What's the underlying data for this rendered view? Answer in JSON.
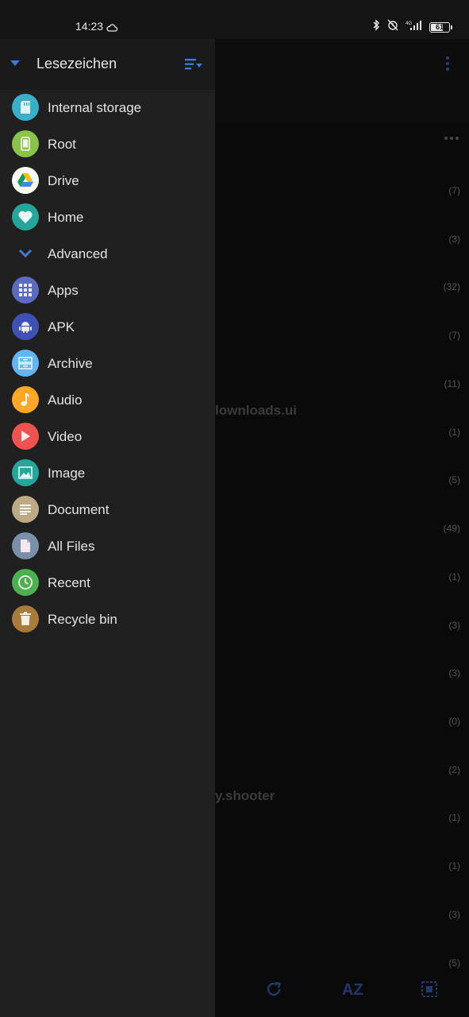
{
  "status_bar": {
    "time": "14:23",
    "battery": "61",
    "network": "4G"
  },
  "drawer": {
    "title": "Lesezeichen",
    "items": [
      {
        "label": "Internal storage",
        "icon": "sd-card-icon",
        "color": "#3ab0c8"
      },
      {
        "label": "Root",
        "icon": "phone-icon",
        "color": "#8bc34a"
      },
      {
        "label": "Drive",
        "icon": "google-drive-icon",
        "color": "#ffffff"
      },
      {
        "label": "Home",
        "icon": "heart-icon",
        "color": "#26a69a"
      },
      {
        "label": "Advanced",
        "icon": "chevron-down-icon",
        "color": "#3d78d8"
      },
      {
        "label": "Apps",
        "icon": "apps-grid-icon",
        "color": "#5c6bc0"
      },
      {
        "label": "APK",
        "icon": "android-icon",
        "color": "#3f51b5"
      },
      {
        "label": "Archive",
        "icon": "archive-icon",
        "color": "#64b5f6"
      },
      {
        "label": "Audio",
        "icon": "music-note-icon",
        "color": "#ffa726"
      },
      {
        "label": "Video",
        "icon": "play-icon",
        "color": "#ef5350"
      },
      {
        "label": "Image",
        "icon": "image-icon",
        "color": "#26a69a"
      },
      {
        "label": "Document",
        "icon": "document-icon",
        "color": "#bcaa84"
      },
      {
        "label": "All Files",
        "icon": "file-icon",
        "color": "#7a8fa8"
      },
      {
        "label": "Recent",
        "icon": "clock-icon",
        "color": "#4caf50"
      },
      {
        "label": "Recycle bin",
        "icon": "trash-icon",
        "color": "#a87a3c"
      }
    ]
  },
  "background": {
    "counts": [
      "(7)",
      "(3)",
      "(32)",
      "(7)",
      "(11)",
      "(1)",
      "(5)",
      "(49)",
      "(1)",
      "(3)",
      "(3)",
      "(0)",
      "(2)",
      "(1)",
      "(1)",
      "(3)",
      "(5)"
    ],
    "partial_texts": [
      "lownloads.ui",
      "y.shooter"
    ],
    "sort_label": "AZ"
  }
}
